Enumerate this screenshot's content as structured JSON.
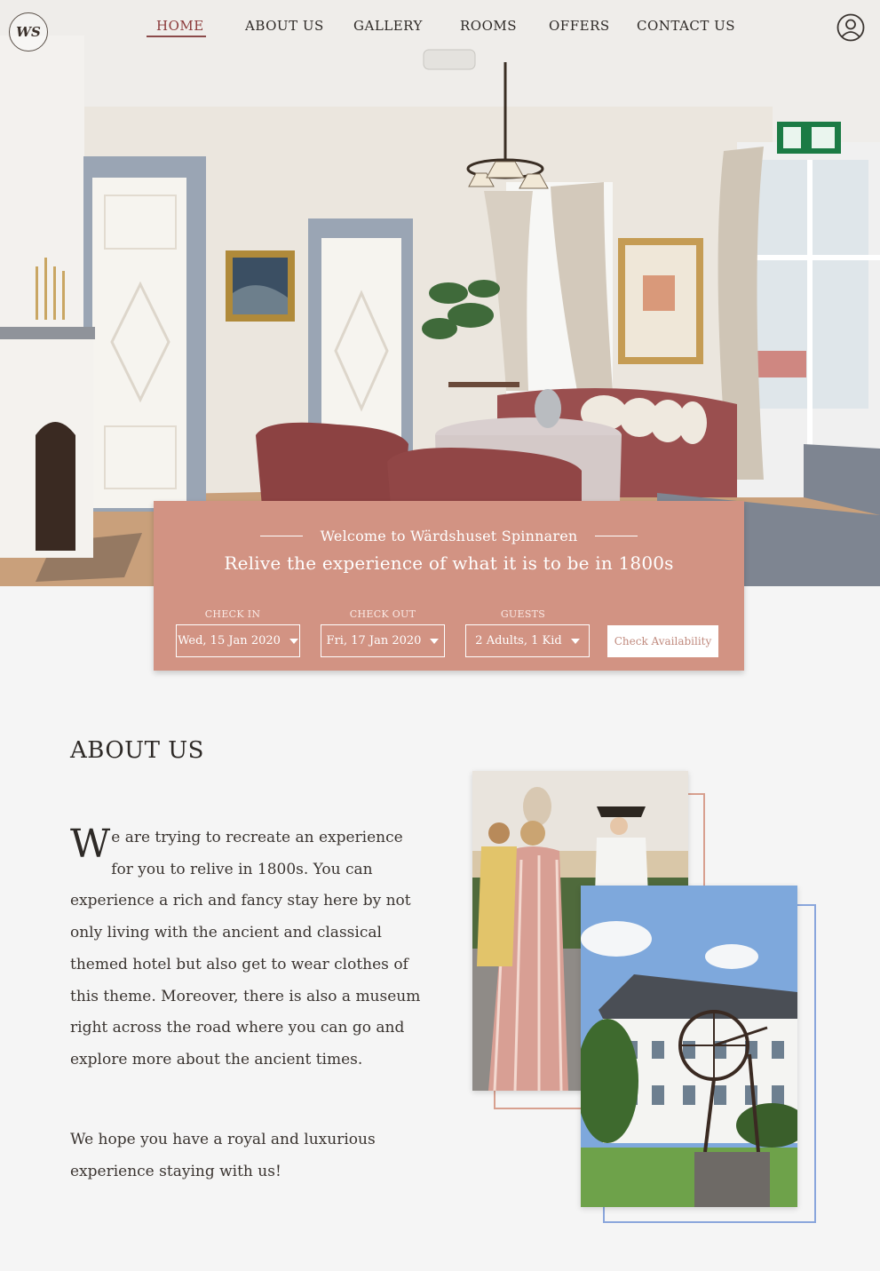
{
  "nav": {
    "logo_text": "WS",
    "items": [
      {
        "label": "HOME",
        "active": true
      },
      {
        "label": "ABOUT US",
        "active": false
      },
      {
        "label": "GALLERY",
        "active": false
      },
      {
        "label": "ROOMS",
        "active": false
      },
      {
        "label": "OFFERS",
        "active": false
      },
      {
        "label": "CONTACT US",
        "active": false
      }
    ],
    "account_icon": "user-circle-icon"
  },
  "booking": {
    "welcome": "Welcome to Wärdshuset Spinnaren",
    "tagline": "Relive the experience of what it is to be in 1800s",
    "check_in": {
      "label": "CHECK IN",
      "value": "Wed, 15 Jan 2020"
    },
    "check_out": {
      "label": "CHECK OUT",
      "value": "Fri, 17 Jan 2020"
    },
    "guests": {
      "label": "GUESTS",
      "value": "2 Adults, 1 Kid"
    },
    "button": "Check Availability"
  },
  "about": {
    "title": "ABOUT US",
    "dropcap": "W",
    "body": "e are trying to recreate an experience for you to relive in 1800s. You can experience a rich and fancy stay here by not only living with the ancient and classical themed hotel but also get to wear clothes of this theme. Moreover, there is also a museum right across the road where you can go and explore more about the ancient times.",
    "closing": "We hope you have a royal and luxurious experience staying with us!"
  },
  "colors": {
    "booking_bg": "#d29383",
    "pink_frame": "#d8a08f",
    "blue_frame": "#8aa6dc",
    "active_nav": "#8b3a3a"
  }
}
